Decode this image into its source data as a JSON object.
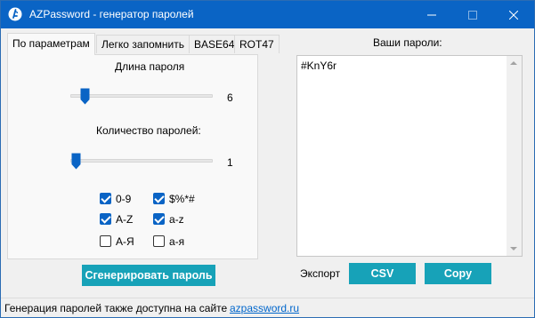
{
  "window": {
    "title": "AZPassword - генератор паролей",
    "accent_color": "#0a64c5"
  },
  "tabs": [
    {
      "label": "По параметрам",
      "active": true
    },
    {
      "label": "Легко запомнить",
      "active": false
    },
    {
      "label": "BASE64",
      "active": false
    },
    {
      "label": "ROT47",
      "active": false
    }
  ],
  "params": {
    "length_label": "Длина пароля",
    "length_value": "6",
    "count_label": "Количество паролей:",
    "count_value": "1",
    "checkboxes": [
      {
        "label": "0-9",
        "checked": true
      },
      {
        "label": "$%*#",
        "checked": true
      },
      {
        "label": "A-Z",
        "checked": true
      },
      {
        "label": "a-z",
        "checked": true
      },
      {
        "label": "А-Я",
        "checked": false
      },
      {
        "label": "а-я",
        "checked": false
      }
    ],
    "generate_label": "Сгенерировать пароль"
  },
  "passwords": {
    "title": "Ваши пароли:",
    "content": "#KnY6r"
  },
  "export": {
    "label": "Экспорт",
    "csv_label": "CSV",
    "copy_label": "Copy",
    "button_color": "#17a2b8"
  },
  "status": {
    "text": "Генерация паролей также доступна на сайте",
    "link": "azpassword.ru"
  }
}
